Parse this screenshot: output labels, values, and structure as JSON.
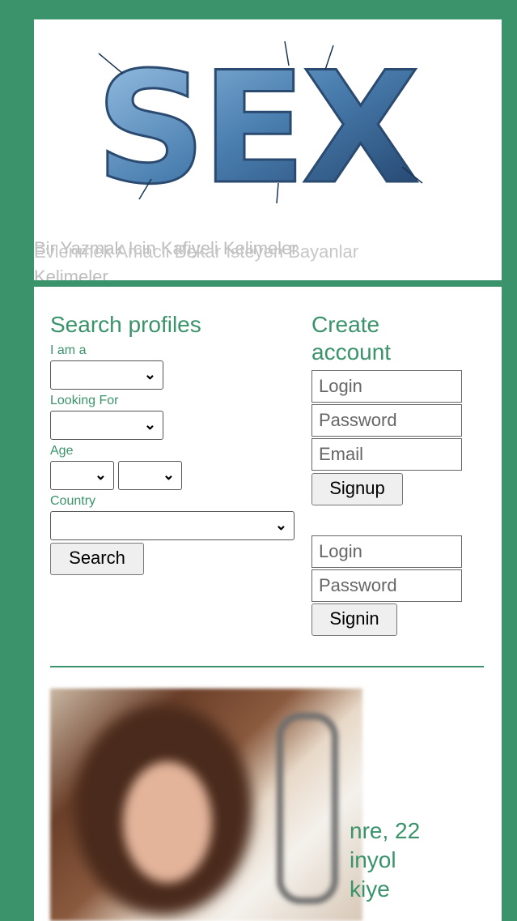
{
  "header": {
    "logo_text": "SEX",
    "tagline_1": "Bir Yazmak Icin Kafiyeli Kelimeler",
    "tagline_2": "Evlenmek Amacli Bekar Isteyen Bayanlar",
    "tagline_3": "Kelimeler"
  },
  "search": {
    "title": "Search profiles",
    "i_am_label": "I am a",
    "looking_for_label": "Looking For",
    "age_label": "Age",
    "country_label": "Country",
    "search_button": "Search"
  },
  "create": {
    "title_1": "Create",
    "title_2": "account",
    "login_placeholder": "Login",
    "password_placeholder": "Password",
    "email_placeholder": "Email",
    "signup_button": "Signup"
  },
  "signin": {
    "login_placeholder": "Login",
    "password_placeholder": "Password",
    "signin_button": "Signin"
  },
  "profile": {
    "line_1": "nre, 22",
    "line_2": "inyol",
    "line_3": "kiye"
  },
  "colors": {
    "brand_green": "#3a936a"
  }
}
